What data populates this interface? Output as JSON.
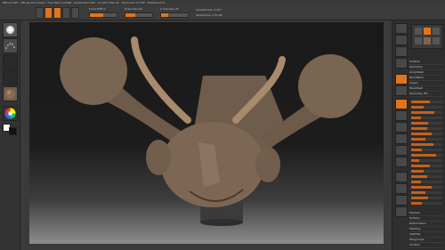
{
  "window": {
    "title": "ZBrush 4R7  ·  ZBrush Document  ·  Free Mem 4.24GB  ·  Active Mem 641  ·  Scratch Disk 49  ·  PolyCount 2.3 MP  ·  MeshCount 8"
  },
  "toolbar": {
    "buttons": [
      "Edit",
      "Draw",
      "Move",
      "Scale",
      "Rotate"
    ],
    "sliders": [
      {
        "label": "Focal Shift 0",
        "value": 0.5
      },
      {
        "label": "Draw Size 64",
        "value": 0.35
      },
      {
        "label": "Z Intensity 25",
        "value": 0.25
      },
      {
        "label": "ActivePoints: 2,307",
        "value": 0
      },
      {
        "label": "TotalPoints: 2.33 Mil",
        "value": 0
      }
    ]
  },
  "left_shelf": {
    "tools": [
      "brush-icon",
      "stroke-icon",
      "alpha-icon",
      "texture-icon",
      "material-icon",
      "color-picker-icon",
      "swatch-icon"
    ]
  },
  "right_panel": {
    "menu": [
      "Subtool",
      "Geometry",
      "ArrayMesh",
      "NanoMesh",
      "Layers",
      "FiberMesh",
      "Geometry HD",
      "Preview",
      "Surface",
      "Deformation",
      "Masking",
      "Visibility",
      "Polygroups",
      "Contact",
      "Morph Target",
      "Polypaint",
      "UV Map",
      "Texture Map",
      "Displace Map",
      "Normal Map",
      "Vector Displace Map",
      "Display Properties",
      "Unified Skin",
      "Initialize",
      "Import",
      "Export"
    ]
  },
  "colors": {
    "accent": "#e2741c",
    "panel": "#2d2d2d",
    "model": "#7d6754"
  }
}
